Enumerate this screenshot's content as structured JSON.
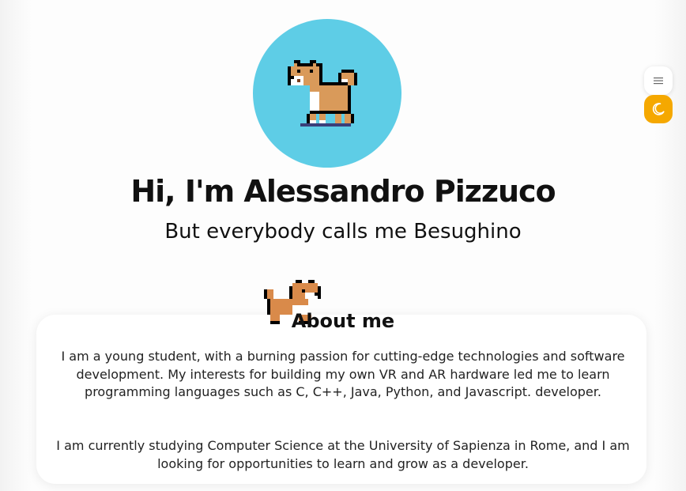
{
  "hero": {
    "title": "Hi, I'm Alessandro Pizzuco",
    "subtitle": "But everybody calls me Besughino",
    "avatar_bg": "#5ecde6"
  },
  "controls": {
    "menu_icon": "hamburger-icon",
    "theme_icon": "moon-icon",
    "theme_button_color": "#f5a800"
  },
  "about": {
    "heading": "About me",
    "paragraph_1": "I am a young student, with a burning passion for cutting-edge technologies and software development. My interests for building my own VR and AR hardware led me to learn programming languages such as C, C++, Java, Python, and Javascript. developer.",
    "paragraph_2": "I am currently studying Computer Science at the University of Sapienza in Rome, and I am looking for opportunities to learn and grow as a developer."
  }
}
